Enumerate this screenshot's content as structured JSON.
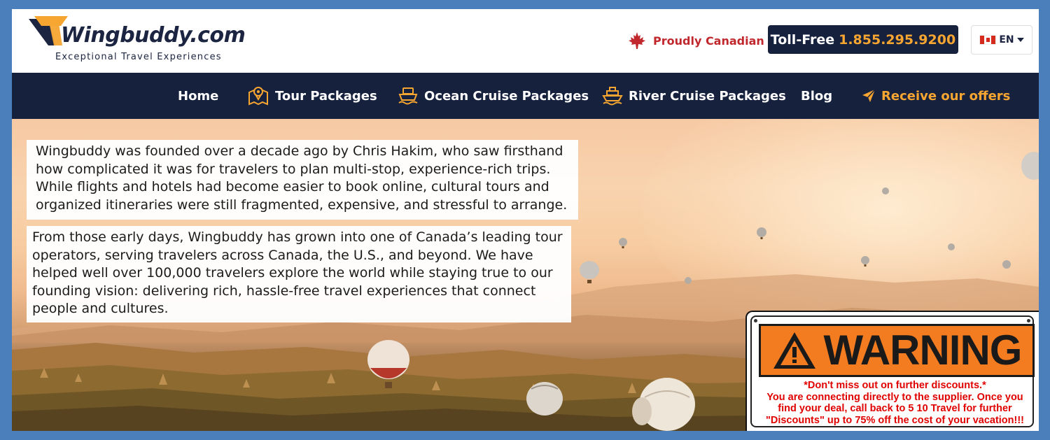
{
  "brand": {
    "name": "Wingbuddy.com",
    "tagline": "Exceptional Travel Experiences"
  },
  "header": {
    "proud_label": "Proudly Canadian",
    "tollfree_label": "Toll-Free",
    "tollfree_number": "1.855.295.9200",
    "language": "EN",
    "icons": [
      "maple-leaf-icon",
      "canada-flag-icon",
      "caret-down-icon"
    ]
  },
  "nav": {
    "items": [
      {
        "label": "Home",
        "icon": ""
      },
      {
        "label": "Tour Packages",
        "icon": "map-pin-icon"
      },
      {
        "label": "Ocean Cruise Packages",
        "icon": "ship-icon"
      },
      {
        "label": "River Cruise Packages",
        "icon": "boat-icon"
      },
      {
        "label": "Blog",
        "icon": ""
      },
      {
        "label": "Receive our offers",
        "icon": "paper-plane-icon"
      }
    ]
  },
  "hero": {
    "paragraph1": [
      "Wingbuddy was founded over a decade ago by Chris Hakim, who saw firsthand",
      "how complicated it was for travelers to plan multi-stop, experience-rich trips.",
      "While flights and hotels had become easier to book online, cultural tours and",
      "organized itineraries were still fragmented, expensive, and stressful to arrange."
    ],
    "paragraph2": [
      "From those early days, Wingbuddy has grown into one of Canada’s leading tour",
      "operators, serving travelers across Canada, the U.S., and beyond. We have",
      "helped well over 100,000 travelers explore the world while staying true to our",
      "founding vision: delivering rich, hassle-free travel experiences that connect",
      "people and cultures."
    ]
  },
  "warning": {
    "title": "WARNING",
    "lines": [
      "*Don't miss out on further discounts.*",
      "You are connecting directly to the supplier. Once you",
      "find your deal, call back to 5 10 Travel for further",
      "\"Discounts\" up to 75% off the cost of your vacation!!!"
    ]
  },
  "colors": {
    "page_border": "#4a7fbb",
    "navy": "#16213e",
    "orange": "#f7a531",
    "canada_red": "#c0282d",
    "warning_orange": "#f47c20",
    "warning_text": "#e00000"
  }
}
